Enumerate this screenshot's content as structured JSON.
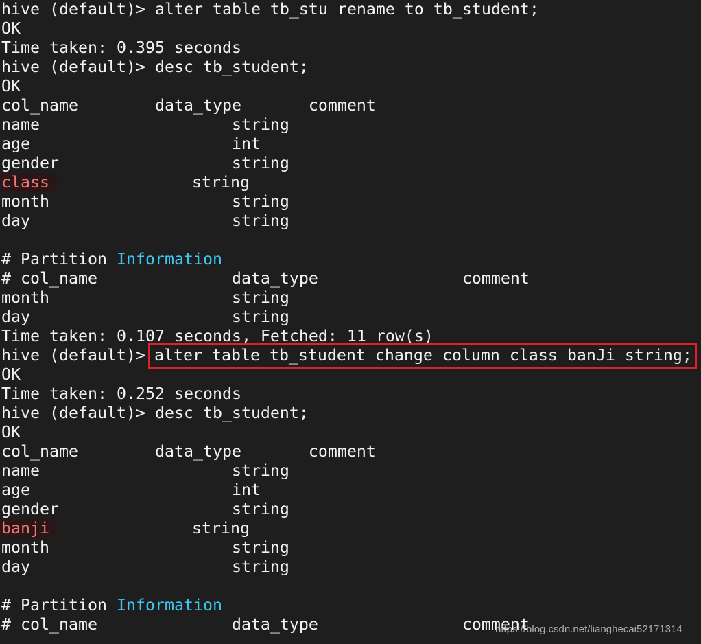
{
  "terminal": {
    "colors": {
      "background": "#1e1e1e",
      "text": "#f2f2f2",
      "highlight": "#f07878",
      "keyword": "#3ec6f2",
      "box": "#e0202a"
    },
    "lines": [
      [
        {
          "t": "hive (default)> alter table tb_stu rename to tb_student;"
        }
      ],
      [
        {
          "t": "OK"
        }
      ],
      [
        {
          "t": "Time taken: 0.395 seconds"
        }
      ],
      [
        {
          "t": "hive (default)> desc tb_student;"
        }
      ],
      [
        {
          "t": "OK"
        }
      ],
      [
        {
          "t": "col_name        data_type       comment"
        }
      ],
      [
        {
          "t": "name                    string"
        }
      ],
      [
        {
          "t": "age                     int"
        }
      ],
      [
        {
          "t": "gender                  string"
        }
      ],
      [
        {
          "t": "class",
          "s": "hl"
        },
        {
          "t": "              string"
        }
      ],
      [
        {
          "t": "month                   string"
        }
      ],
      [
        {
          "t": "day                     string"
        }
      ],
      [
        {
          "t": ""
        }
      ],
      [
        {
          "t": "# Partition "
        },
        {
          "t": "Information",
          "s": "info"
        }
      ],
      [
        {
          "t": "# col_name              data_type               comment"
        }
      ],
      [
        {
          "t": "month                   string"
        }
      ],
      [
        {
          "t": "day                     string"
        }
      ],
      [
        {
          "t": "Time taken: 0.107 seconds, Fetched: 11 row(s)"
        }
      ],
      [
        {
          "t": "hive (default)> "
        },
        {
          "t": "alter table tb_student change column class banJi string;",
          "s": "boxed"
        }
      ],
      [
        {
          "t": "OK"
        }
      ],
      [
        {
          "t": "Time taken: 0.252 seconds"
        }
      ],
      [
        {
          "t": "hive (default)> desc tb_student;"
        }
      ],
      [
        {
          "t": "OK"
        }
      ],
      [
        {
          "t": "col_name        data_type       comment"
        }
      ],
      [
        {
          "t": "name                    string"
        }
      ],
      [
        {
          "t": "age                     int"
        }
      ],
      [
        {
          "t": "gender                  string"
        }
      ],
      [
        {
          "t": "banji",
          "s": "hl"
        },
        {
          "t": "              string"
        }
      ],
      [
        {
          "t": "month                   string"
        }
      ],
      [
        {
          "t": "day                     string"
        }
      ],
      [
        {
          "t": ""
        }
      ],
      [
        {
          "t": "# Partition "
        },
        {
          "t": "Information",
          "s": "info"
        }
      ],
      [
        {
          "t": "# col_name              data_type               comment"
        }
      ]
    ]
  },
  "watermark": "https://blog.csdn.net/lianghecai52171314"
}
